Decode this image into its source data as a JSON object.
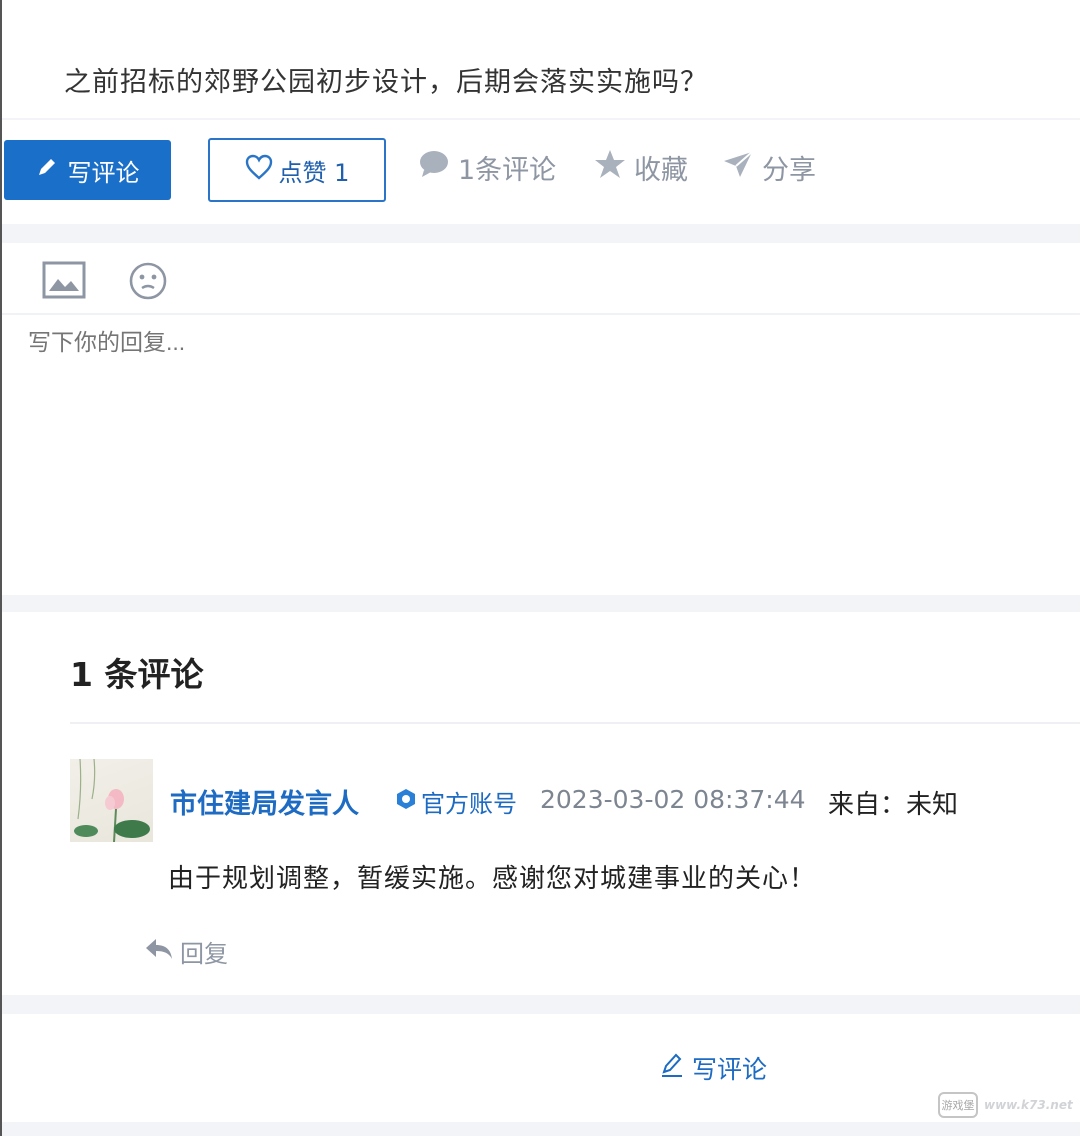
{
  "question": {
    "text": "之前招标的郊野公园初步设计，后期会落实实施吗？"
  },
  "actions": {
    "write_comment": "写评论",
    "like": "点赞 1",
    "comments_count": "1条评论",
    "favorite": "收藏",
    "share": "分享"
  },
  "reply": {
    "placeholder": "写下你的回复...",
    "tools": [
      "image-icon",
      "emoji-icon"
    ]
  },
  "comments": {
    "title": "1 条评论",
    "items": [
      {
        "author": "市住建局发言人",
        "badge": "官方账号",
        "timestamp": "2023-03-02 08:37:44",
        "source": "来自：未知",
        "text": "由于规划调整，暂缓实施。感谢您对城建事业的关心！",
        "reply_label": "回复"
      }
    ]
  },
  "footer": {
    "write_comment": "写评论"
  },
  "watermark": {
    "logo": "游戏堡",
    "text": "www.k73.net"
  },
  "colors": {
    "primary": "#1a6fc9",
    "link": "#1d6bc2",
    "muted": "#8e96a3"
  }
}
